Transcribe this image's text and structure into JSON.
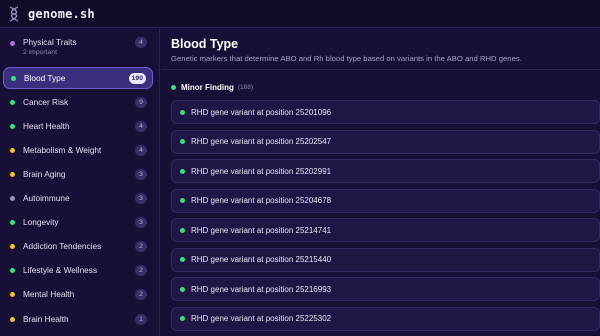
{
  "app": {
    "title": "genome.sh",
    "logo_icon": "dna-icon"
  },
  "sidebar": {
    "items": [
      {
        "label": "Physical Traits",
        "sublabel": "2 important",
        "count": "4",
        "dot_color": "#b56cf0",
        "active": false
      },
      {
        "label": "Blood Type",
        "count": "190",
        "dot_color": "#3ee07a",
        "active": true
      },
      {
        "label": "Cancer Risk",
        "count": "9",
        "dot_color": "#3ee07a",
        "active": false
      },
      {
        "label": "Heart Health",
        "count": "4",
        "dot_color": "#3ee07a",
        "active": false
      },
      {
        "label": "Metabolism & Weight",
        "count": "4",
        "dot_color": "#f2c230",
        "active": false
      },
      {
        "label": "Brain Aging",
        "count": "3",
        "dot_color": "#f2c230",
        "active": false
      },
      {
        "label": "Autoimmune",
        "count": "3",
        "dot_color": "#9a95b8",
        "active": false
      },
      {
        "label": "Longevity",
        "count": "3",
        "dot_color": "#3ee07a",
        "active": false
      },
      {
        "label": "Addiction Tendencies",
        "count": "2",
        "dot_color": "#f2c230",
        "active": false
      },
      {
        "label": "Lifestyle & Wellness",
        "count": "2",
        "dot_color": "#3ee07a",
        "active": false
      },
      {
        "label": "Mental Health",
        "count": "2",
        "dot_color": "#f2c230",
        "active": false
      },
      {
        "label": "Brain Health",
        "count": "1",
        "dot_color": "#f2c230",
        "active": false
      }
    ]
  },
  "main": {
    "title": "Blood Type",
    "description": "Genetic markers that determine ABO and Rh blood type based on variants in the ABO and RHD genes.",
    "section": {
      "label": "Minor Finding",
      "count": "(188)",
      "dot_color": "#3ee07a"
    },
    "findings": [
      "RHD gene variant at position 25201096",
      "RHD gene variant at position 25202547",
      "RHD gene variant at position 25202991",
      "RHD gene variant at position 25204678",
      "RHD gene variant at position 25214741",
      "RHD gene variant at position 25215440",
      "RHD gene variant at position 25216993",
      "RHD gene variant at position 25225302"
    ]
  }
}
